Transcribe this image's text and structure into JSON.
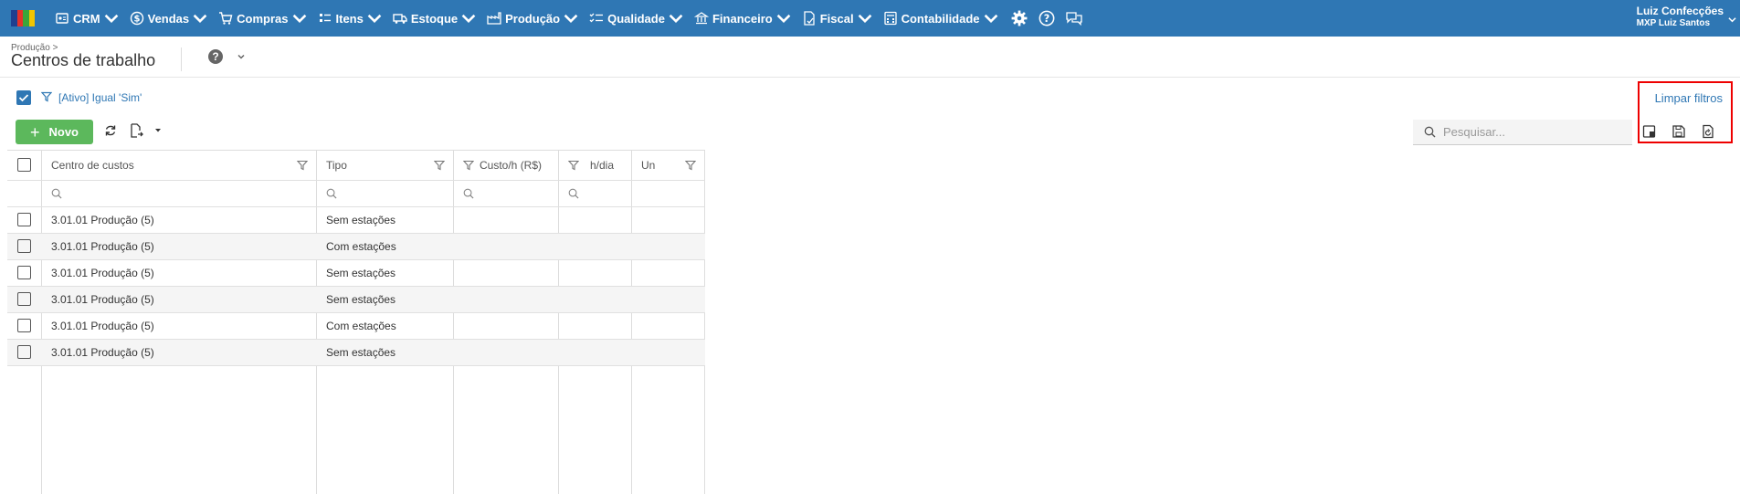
{
  "nav": {
    "items": [
      {
        "label": "CRM",
        "icon": "crm-icon"
      },
      {
        "label": "Vendas",
        "icon": "dollar-icon"
      },
      {
        "label": "Compras",
        "icon": "cart-icon"
      },
      {
        "label": "Itens",
        "icon": "items-icon"
      },
      {
        "label": "Estoque",
        "icon": "truck-icon"
      },
      {
        "label": "Produção",
        "icon": "factory-icon"
      },
      {
        "label": "Qualidade",
        "icon": "checklist-icon"
      },
      {
        "label": "Financeiro",
        "icon": "bank-icon"
      },
      {
        "label": "Fiscal",
        "icon": "document-icon"
      },
      {
        "label": "Contabilidade",
        "icon": "calculator-icon"
      }
    ],
    "user": {
      "name": "Luiz Confecções",
      "company": "MXP Luiz Santos"
    }
  },
  "header": {
    "breadcrumb": "Produção >",
    "title": "Centros de trabalho"
  },
  "filter": {
    "text": "[Ativo] Igual 'Sim'",
    "clear_label": "Limpar filtros"
  },
  "toolbar": {
    "new_label": "Novo",
    "search_placeholder": "Pesquisar..."
  },
  "table": {
    "columns": [
      "Centro de custos",
      "Tipo",
      "Custo/h (R$)",
      "h/dia",
      "Un"
    ],
    "rows": [
      {
        "centro": "3.01.01 Produção (5)",
        "tipo": "Sem estações"
      },
      {
        "centro": "3.01.01 Produção (5)",
        "tipo": "Com estações"
      },
      {
        "centro": "3.01.01 Produção (5)",
        "tipo": "Sem estações"
      },
      {
        "centro": "3.01.01 Produção (5)",
        "tipo": "Sem estações"
      },
      {
        "centro": "3.01.01 Produção (5)",
        "tipo": "Com estações"
      },
      {
        "centro": "3.01.01 Produção (5)",
        "tipo": "Sem estações"
      }
    ]
  },
  "colors": {
    "primary": "#2f77b4",
    "success": "#5cb85c",
    "highlight": "#e00000"
  }
}
